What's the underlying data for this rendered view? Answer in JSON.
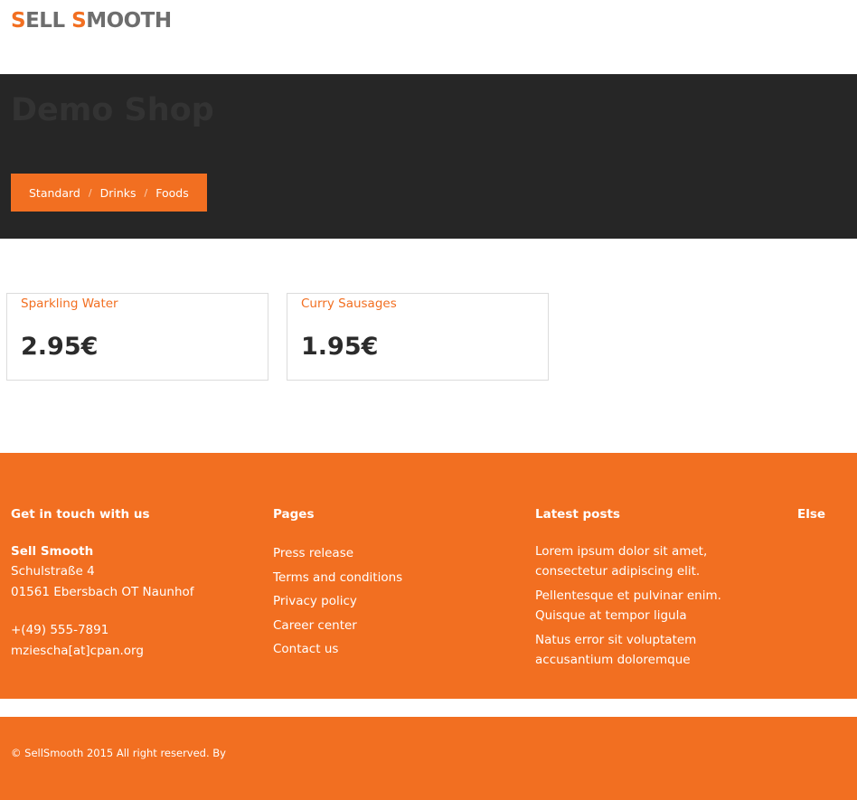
{
  "header": {
    "logo_first_initial": "S",
    "logo_first_rest": "ELL ",
    "logo_second_initial": "S",
    "logo_second_rest": "MOOTH"
  },
  "hero": {
    "title": "Demo Shop",
    "breadcrumb": [
      "Standard",
      "Drinks",
      "Foods"
    ],
    "separator": "/"
  },
  "products": [
    {
      "name": "Sparkling Water",
      "price": "2.95€"
    },
    {
      "name": "Curry Sausages",
      "price": "1.95€"
    }
  ],
  "footer": {
    "contact": {
      "heading": "Get in touch with us",
      "company": "Sell Smooth",
      "street": "Schulstraße 4",
      "city": "01561 Ebersbach OT Naunhof",
      "phone": "+(49) 555-7891",
      "email": "mziescha[at]cpan.org"
    },
    "pages": {
      "heading": "Pages",
      "links": [
        "Press release",
        "Terms and conditions",
        "Privacy policy",
        "Career center",
        "Contact us"
      ]
    },
    "posts": {
      "heading": "Latest posts",
      "items": [
        "Lorem ipsum dolor sit amet, consectetur adipiscing elit.",
        "Pellentesque et pulvinar enim. Quisque at tempor ligula",
        "Natus error sit voluptatem accusantium doloremque"
      ]
    },
    "else": {
      "heading": "Else"
    },
    "copyright": "© SellSmooth 2015 All right reserved. By"
  },
  "colors": {
    "accent": "#f26f21",
    "hero_bg": "#262626",
    "logo_gray": "#6e6e6e"
  }
}
